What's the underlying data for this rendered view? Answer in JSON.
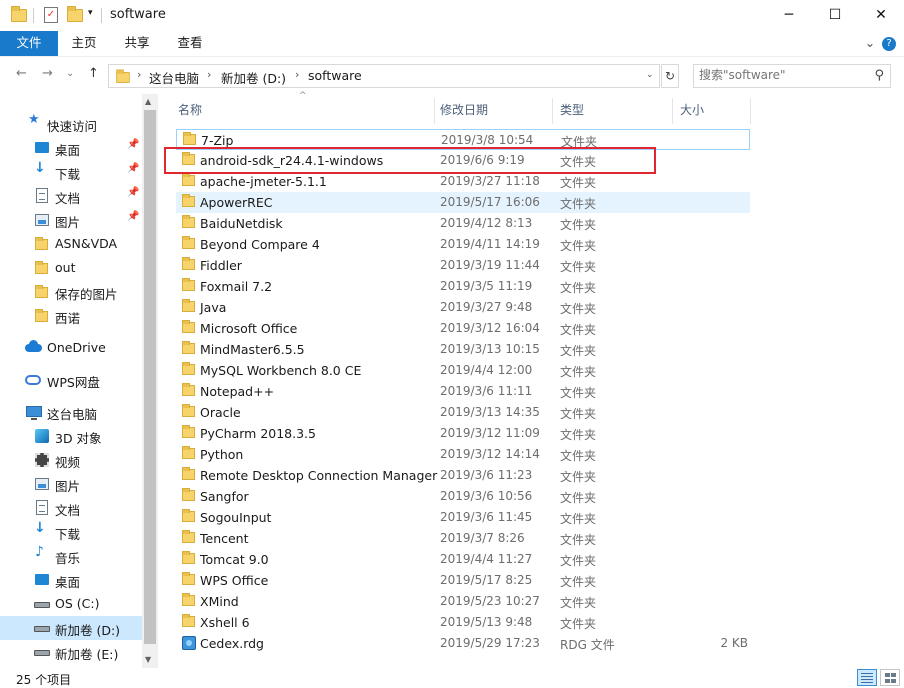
{
  "window": {
    "title": "software",
    "controls": {
      "minimize": "─",
      "maximize": "☐",
      "close": "✕"
    }
  },
  "ribbon": {
    "tabs": [
      "文件",
      "主页",
      "共享",
      "查看"
    ],
    "expand": "⌄",
    "help": "?"
  },
  "nav": {
    "back": "←",
    "forward": "→",
    "recent": "⌄",
    "up": "↑"
  },
  "address": {
    "crumbs": [
      "这台电脑",
      "新加卷 (D:)",
      "software"
    ],
    "separator": "›"
  },
  "search": {
    "placeholder": "搜索\"software\""
  },
  "sidebar": {
    "items": [
      {
        "label": "快速访问",
        "icon": "star-icon"
      },
      {
        "label": "桌面",
        "icon": "desktop-icon",
        "pinned": true
      },
      {
        "label": "下载",
        "icon": "download-icon",
        "pinned": true
      },
      {
        "label": "文档",
        "icon": "document-icon",
        "pinned": true
      },
      {
        "label": "图片",
        "icon": "picture-icon",
        "pinned": true
      },
      {
        "label": "ASN&VDA",
        "icon": "folder-icon"
      },
      {
        "label": "out",
        "icon": "folder-icon"
      },
      {
        "label": "保存的图片",
        "icon": "folder-icon"
      },
      {
        "label": "西诺",
        "icon": "folder-icon"
      },
      {
        "label": "OneDrive",
        "icon": "onedrive-icon"
      },
      {
        "label": "WPS网盘",
        "icon": "wps-cloud-icon"
      },
      {
        "label": "这台电脑",
        "icon": "computer-icon"
      },
      {
        "label": "3D 对象",
        "icon": "3d-objects-icon"
      },
      {
        "label": "视频",
        "icon": "video-icon"
      },
      {
        "label": "图片",
        "icon": "picture-icon"
      },
      {
        "label": "文档",
        "icon": "document-icon"
      },
      {
        "label": "下载",
        "icon": "download-icon"
      },
      {
        "label": "音乐",
        "icon": "music-icon"
      },
      {
        "label": "桌面",
        "icon": "desktop-icon"
      },
      {
        "label": "OS (C:)",
        "icon": "drive-icon"
      },
      {
        "label": "新加卷 (D:)",
        "icon": "drive-icon",
        "selected": true
      },
      {
        "label": "新加卷 (E:)",
        "icon": "drive-icon"
      }
    ]
  },
  "columns": {
    "name": "名称",
    "date": "修改日期",
    "type": "类型",
    "size": "大小"
  },
  "files": [
    {
      "name": "7-Zip",
      "date": "2019/3/8 10:54",
      "type": "文件夹",
      "size": ""
    },
    {
      "name": "android-sdk_r24.4.1-windows",
      "date": "2019/6/6 9:19",
      "type": "文件夹",
      "size": ""
    },
    {
      "name": "apache-jmeter-5.1.1",
      "date": "2019/3/27 11:18",
      "type": "文件夹",
      "size": ""
    },
    {
      "name": "ApowerREC",
      "date": "2019/5/17 16:06",
      "type": "文件夹",
      "size": ""
    },
    {
      "name": "BaiduNetdisk",
      "date": "2019/4/12 8:13",
      "type": "文件夹",
      "size": ""
    },
    {
      "name": "Beyond Compare 4",
      "date": "2019/4/11 14:19",
      "type": "文件夹",
      "size": ""
    },
    {
      "name": "Fiddler",
      "date": "2019/3/19 11:44",
      "type": "文件夹",
      "size": ""
    },
    {
      "name": "Foxmail 7.2",
      "date": "2019/3/5 11:19",
      "type": "文件夹",
      "size": ""
    },
    {
      "name": "Java",
      "date": "2019/3/27 9:48",
      "type": "文件夹",
      "size": ""
    },
    {
      "name": "Microsoft Office",
      "date": "2019/3/12 16:04",
      "type": "文件夹",
      "size": ""
    },
    {
      "name": "MindMaster6.5.5",
      "date": "2019/3/13 10:15",
      "type": "文件夹",
      "size": ""
    },
    {
      "name": "MySQL Workbench 8.0 CE",
      "date": "2019/4/4 12:00",
      "type": "文件夹",
      "size": ""
    },
    {
      "name": "Notepad++",
      "date": "2019/3/6 11:11",
      "type": "文件夹",
      "size": ""
    },
    {
      "name": "Oracle",
      "date": "2019/3/13 14:35",
      "type": "文件夹",
      "size": ""
    },
    {
      "name": "PyCharm 2018.3.5",
      "date": "2019/3/12 11:09",
      "type": "文件夹",
      "size": ""
    },
    {
      "name": "Python",
      "date": "2019/3/12 14:14",
      "type": "文件夹",
      "size": ""
    },
    {
      "name": "Remote Desktop Connection Manager",
      "date": "2019/3/6 11:23",
      "type": "文件夹",
      "size": ""
    },
    {
      "name": "Sangfor",
      "date": "2019/3/6 10:56",
      "type": "文件夹",
      "size": ""
    },
    {
      "name": "SogouInput",
      "date": "2019/3/6 11:45",
      "type": "文件夹",
      "size": ""
    },
    {
      "name": "Tencent",
      "date": "2019/3/7 8:26",
      "type": "文件夹",
      "size": ""
    },
    {
      "name": "Tomcat 9.0",
      "date": "2019/4/4 11:27",
      "type": "文件夹",
      "size": ""
    },
    {
      "name": "WPS Office",
      "date": "2019/5/17 8:25",
      "type": "文件夹",
      "size": ""
    },
    {
      "name": "XMind",
      "date": "2019/5/23 10:27",
      "type": "文件夹",
      "size": ""
    },
    {
      "name": "Xshell 6",
      "date": "2019/5/13 9:48",
      "type": "文件夹",
      "size": ""
    },
    {
      "name": "Cedex.rdg",
      "date": "2019/5/29 17:23",
      "type": "RDG 文件",
      "size": "2 KB"
    }
  ],
  "status": {
    "count": "25 个项目"
  },
  "colors": {
    "accent": "#1979ca",
    "highlight": "#e0262e",
    "selection": "#cce8ff",
    "hover": "#e5f3ff"
  }
}
